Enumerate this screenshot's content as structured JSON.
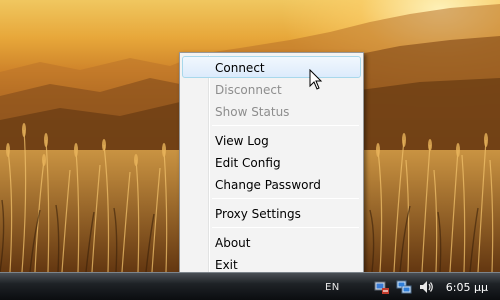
{
  "menu": {
    "items": [
      {
        "label": "Connect",
        "enabled": true,
        "highlighted": true
      },
      {
        "label": "Disconnect",
        "enabled": false
      },
      {
        "label": "Show Status",
        "enabled": false
      },
      {
        "label": "View Log",
        "enabled": true
      },
      {
        "label": "Edit Config",
        "enabled": true
      },
      {
        "label": "Change Password",
        "enabled": true
      },
      {
        "label": "Proxy Settings",
        "enabled": true
      },
      {
        "label": "About",
        "enabled": true
      },
      {
        "label": "Exit",
        "enabled": true
      }
    ]
  },
  "taskbar": {
    "language": "EN",
    "clock": "6:05 μμ",
    "tray_icons": [
      "openvpn-tray-icon",
      "network-icon",
      "volume-icon"
    ]
  },
  "colors": {
    "menu_bg": "#f3f3f3",
    "menu_highlight": "#dcebfc",
    "disabled_text": "#8d8d8d"
  }
}
